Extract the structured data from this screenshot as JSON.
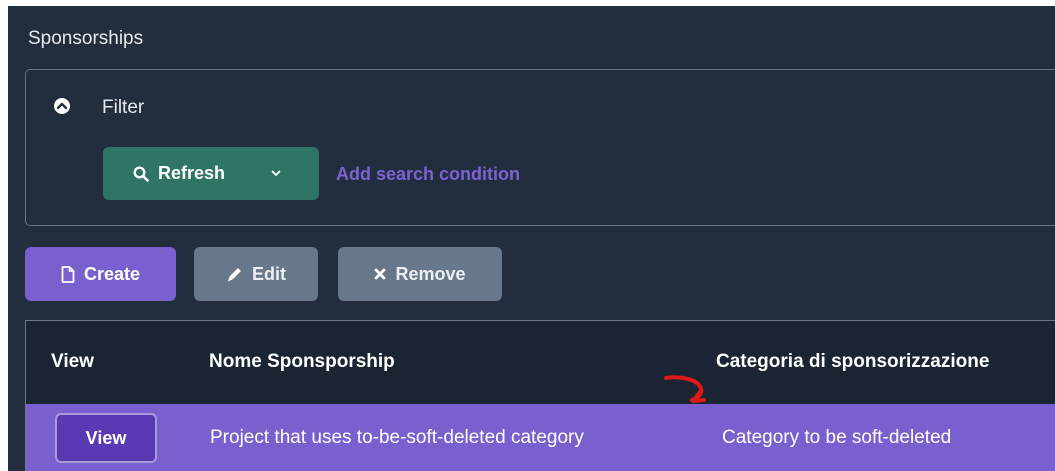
{
  "page": {
    "title": "Sponsorships"
  },
  "filter": {
    "label": "Filter",
    "refresh_label": "Refresh",
    "add_condition_label": "Add search condition"
  },
  "toolbar": {
    "create_label": "Create",
    "edit_label": "Edit",
    "remove_label": "Remove"
  },
  "grid": {
    "columns": [
      "View",
      "Nome Sponsporship",
      "Categoria di sponsorizzazione"
    ],
    "rows": [
      {
        "view_label": "View",
        "nome": "Project that uses to-be-soft-deleted category",
        "categoria": "Category to be soft-deleted",
        "selected": true
      }
    ]
  },
  "colors": {
    "background": "#222d3d",
    "accent": "#7a5fcf",
    "refresh": "#2f7566",
    "disabled_button": "#66788a",
    "annotation": "#e01818"
  }
}
